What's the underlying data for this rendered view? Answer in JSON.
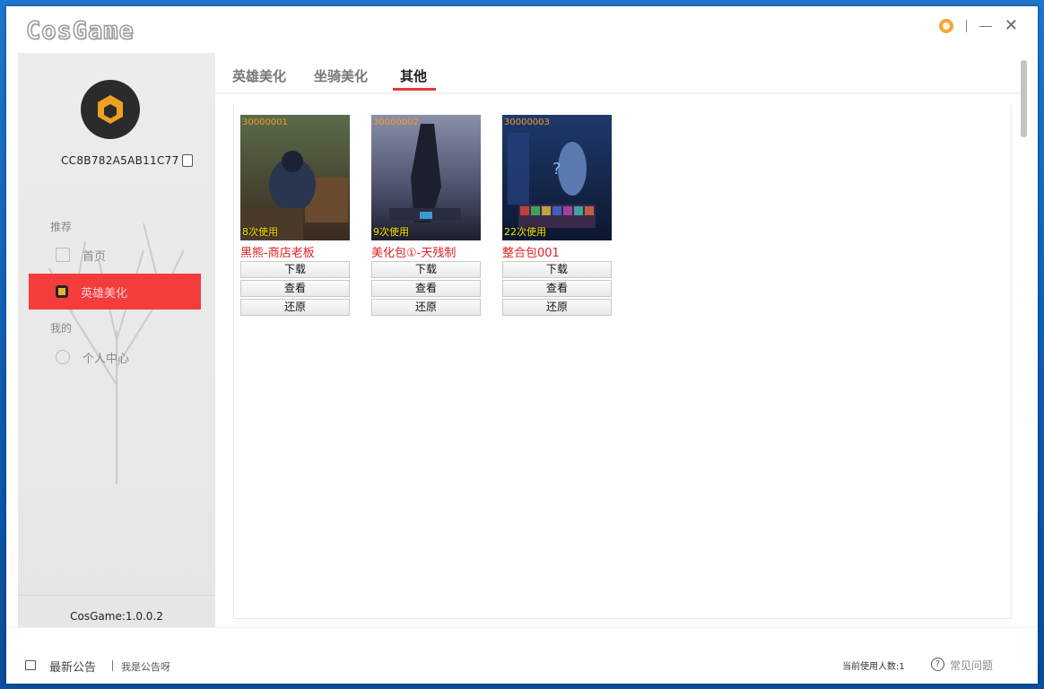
{
  "window": {
    "app_name": "CosGame"
  },
  "sidebar": {
    "user_id": "CC8B782A5AB11C77",
    "sections": [
      {
        "label": "推荐",
        "items": [
          {
            "label": "首页"
          },
          {
            "label": "英雄美化"
          }
        ]
      },
      {
        "label": "我的",
        "items": [
          {
            "label": "个人中心"
          }
        ]
      }
    ],
    "version": "CosGame:1.0.0.2"
  },
  "tabs": [
    {
      "label": "英雄美化"
    },
    {
      "label": "坐骑美化"
    },
    {
      "label": "其他"
    }
  ],
  "cards": [
    {
      "code": "30000001",
      "uses": "8次使用",
      "title": "黑熊-商店老板",
      "buttons": [
        "下载",
        "查看",
        "还原"
      ]
    },
    {
      "code": "30000002",
      "uses": "9次使用",
      "title": "美化包①-天残制",
      "buttons": [
        "下载",
        "查看",
        "还原"
      ]
    },
    {
      "code": "30000003",
      "uses": "22次使用",
      "title": "整合包001",
      "buttons": [
        "下载",
        "查看",
        "还原"
      ]
    }
  ],
  "footer": {
    "notice_title": "最新公告",
    "notice_text": "我是公告呀",
    "online_count_label": "当前使用人数:1",
    "help_label": "常见问题"
  },
  "colors": {
    "accent": "#f53c3c",
    "title_text": "#e02020",
    "count_text": "#ffe600",
    "code_text": "#f59a2a"
  }
}
